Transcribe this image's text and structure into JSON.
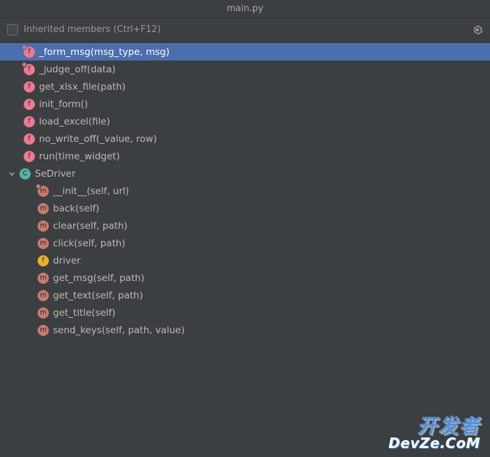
{
  "title": "main.py",
  "toolbar": {
    "inherited_label": "Inherited members (Ctrl+F12)"
  },
  "tree": {
    "items": [
      {
        "icon": "f",
        "locked": true,
        "label": "_form_msg(msg_type, msg)",
        "selected": true,
        "indent": 1
      },
      {
        "icon": "f",
        "locked": true,
        "label": "_judge_off(data)",
        "indent": 1
      },
      {
        "icon": "f",
        "label": "get_xlsx_file(path)",
        "indent": 1
      },
      {
        "icon": "f",
        "label": "init_form()",
        "indent": 1
      },
      {
        "icon": "f",
        "label": "load_excel(file)",
        "indent": 1
      },
      {
        "icon": "f",
        "label": "no_write_off(_value, row)",
        "indent": 1
      },
      {
        "icon": "f",
        "label": "run(time_widget)",
        "indent": 1
      },
      {
        "icon": "c",
        "label": "SeDriver",
        "indent": 0,
        "expandable": true
      },
      {
        "icon": "m",
        "locked": true,
        "label": "__init__(self, url)",
        "indent": 2
      },
      {
        "icon": "m",
        "label": "back(self)",
        "indent": 2
      },
      {
        "icon": "m",
        "label": "clear(self, path)",
        "indent": 2
      },
      {
        "icon": "m",
        "label": "click(self, path)",
        "indent": 2
      },
      {
        "icon": "field",
        "label": "driver",
        "indent": 2
      },
      {
        "icon": "m",
        "label": "get_msg(self, path)",
        "indent": 2
      },
      {
        "icon": "m",
        "label": "get_text(self, path)",
        "indent": 2
      },
      {
        "icon": "m",
        "label": "get_title(self)",
        "indent": 2
      },
      {
        "icon": "m",
        "label": "send_keys(self, path, value)",
        "indent": 2
      }
    ]
  },
  "watermark": {
    "cn": "开发者",
    "en": "DevZe.CoM"
  },
  "iconLetters": {
    "f": "f",
    "m": "m",
    "c": "C",
    "field": "f"
  }
}
